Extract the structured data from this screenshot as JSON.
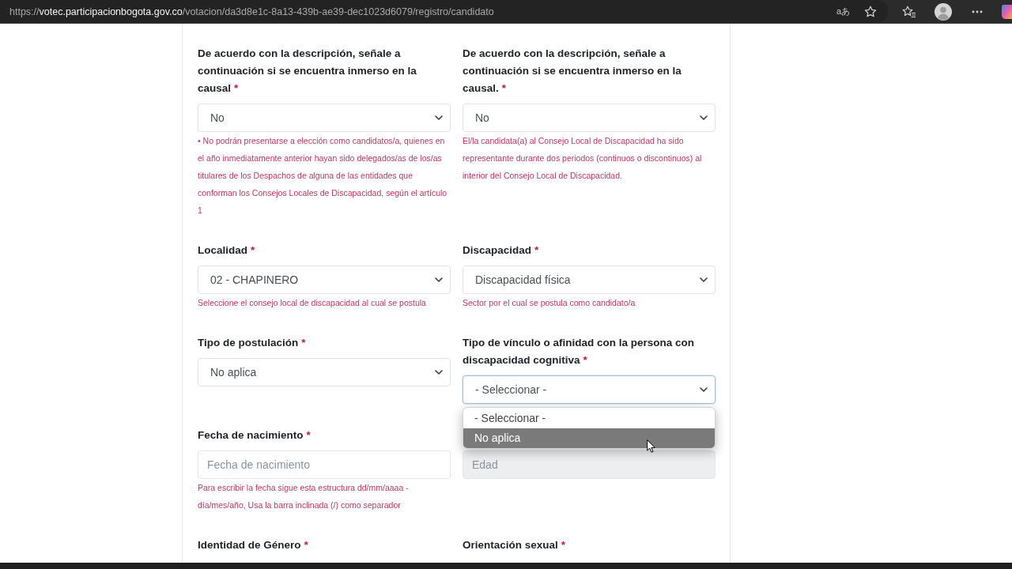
{
  "browser": {
    "url": "https://**votec.participacionbogota.gov.co**/votacion/da3d8e1c-8a13-439b-ae39-dec1023d6079/registro/candidato",
    "translate_label": "aあ"
  },
  "form": {
    "rows": [
      {
        "fields": [
          {
            "kind": "select",
            "label": "De acuerdo con la descripción, señale a continuación si se encuentra inmerso en la causal",
            "required_mark": "*",
            "value": "No",
            "expanded": false,
            "help": "• No podrán presentarse a elección como candidatos/a, quienes en el año inmediatamente anterior hayan sido delegados/as de los/as titulares de los Despachos de alguna de las entidades que conforman los Consejos Locales de Discapacidad, según el artículo 1"
          },
          {
            "kind": "select",
            "label": "De acuerdo con la descripción, señale a continuación si se encuentra inmerso en la causal.",
            "required_mark": "*",
            "value": "No",
            "expanded": false,
            "help": "El/la candidata(a) al Consejo Local de Discapacidad ha sido representante durante dos periodos (continuos o discontinuos) al interior del Consejo Local de Discapacidad."
          }
        ]
      },
      {
        "fields": [
          {
            "kind": "select",
            "label": "Localidad",
            "required_mark": "*",
            "value": "02 - CHAPINERO",
            "expanded": false,
            "help": "Seleccione el consejo local de discapacidad al cual se postula"
          },
          {
            "kind": "select",
            "label": "Discapacidad",
            "required_mark": "*",
            "value": "Discapacidad física",
            "expanded": false,
            "help": "Sector por el cual se postula como candidato/a"
          }
        ]
      },
      {
        "fields": [
          {
            "kind": "select",
            "label": "Tipo de postulación",
            "required_mark": "*",
            "value": "No aplica",
            "expanded": false
          },
          {
            "kind": "select",
            "label": "Tipo de vínculo o afinidad con la persona con discapacidad cognitiva",
            "required_mark": "*",
            "value": "- Seleccionar -",
            "expanded": true,
            "options": [
              {
                "label": "- Seleccionar -",
                "highlighted": false
              },
              {
                "label": "No aplica",
                "highlighted": true
              }
            ]
          }
        ]
      },
      {
        "fields": [
          {
            "kind": "input",
            "label": "Fecha de nacimiento",
            "required_mark": "*",
            "placeholder": "Fecha de nacimiento",
            "disabled": false,
            "help": "Para escribir la fecha sigue esta estructura dd/mm/aaaa - día/mes/año, Usa la barra inclinada (/) como separador"
          },
          {
            "kind": "input",
            "placeholder": "Edad",
            "disabled": true
          }
        ]
      },
      {
        "fields": [
          {
            "kind": "label",
            "label": "Identidad de Género",
            "required_mark": "*"
          },
          {
            "kind": "label",
            "label": "Orientación sexual",
            "required_mark": "*"
          }
        ]
      }
    ]
  }
}
